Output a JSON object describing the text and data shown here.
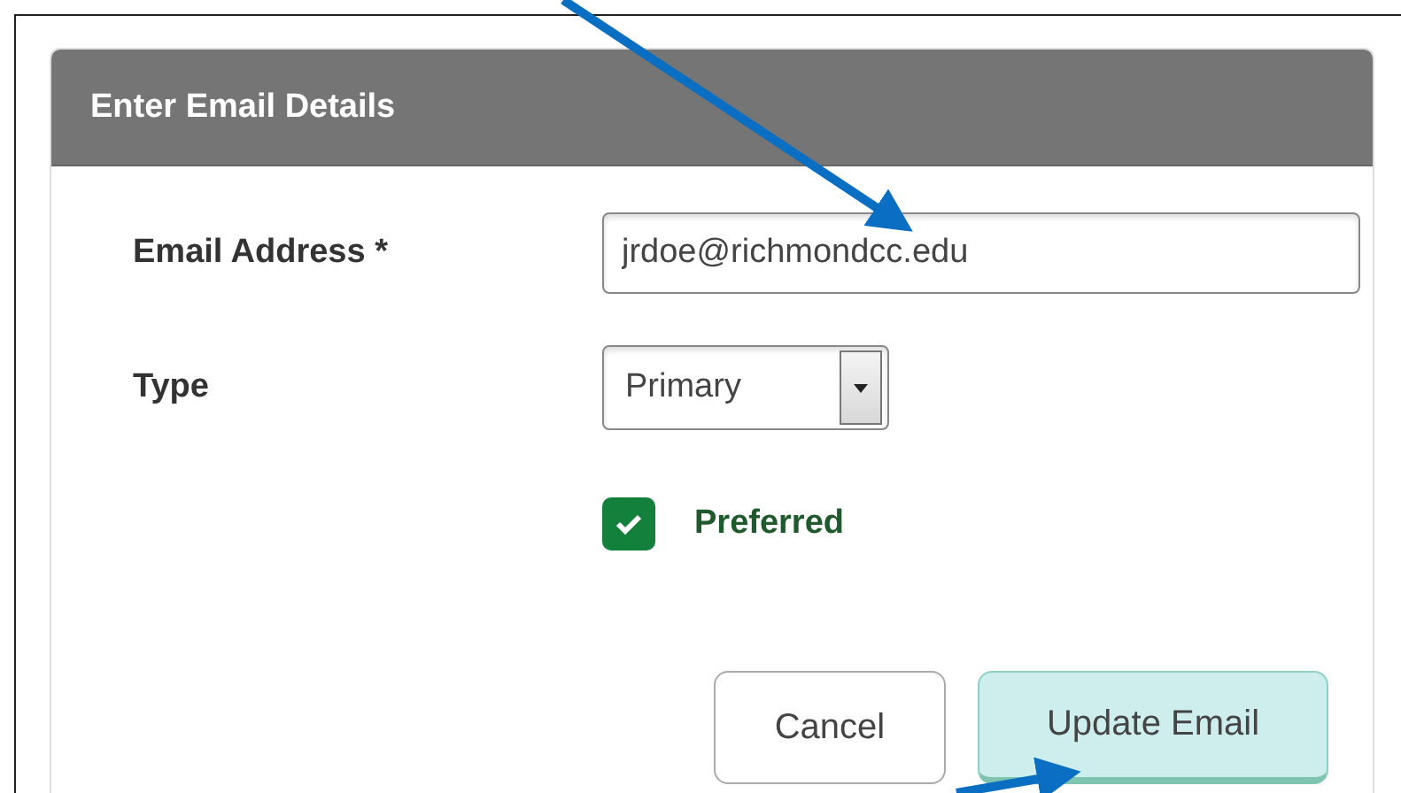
{
  "dialog": {
    "title": "Enter Email Details"
  },
  "fields": [
    {
      "kind": "text",
      "label": "Email Address *",
      "value": "jrdoe@richmondcc.edu"
    },
    {
      "kind": "select",
      "label": "Type",
      "value": "Primary"
    }
  ],
  "preferred": {
    "label": "Preferred",
    "checked": true
  },
  "buttons": [
    {
      "label": "Cancel",
      "kind": "secondary"
    },
    {
      "label": "Update Email",
      "kind": "primary"
    }
  ]
}
